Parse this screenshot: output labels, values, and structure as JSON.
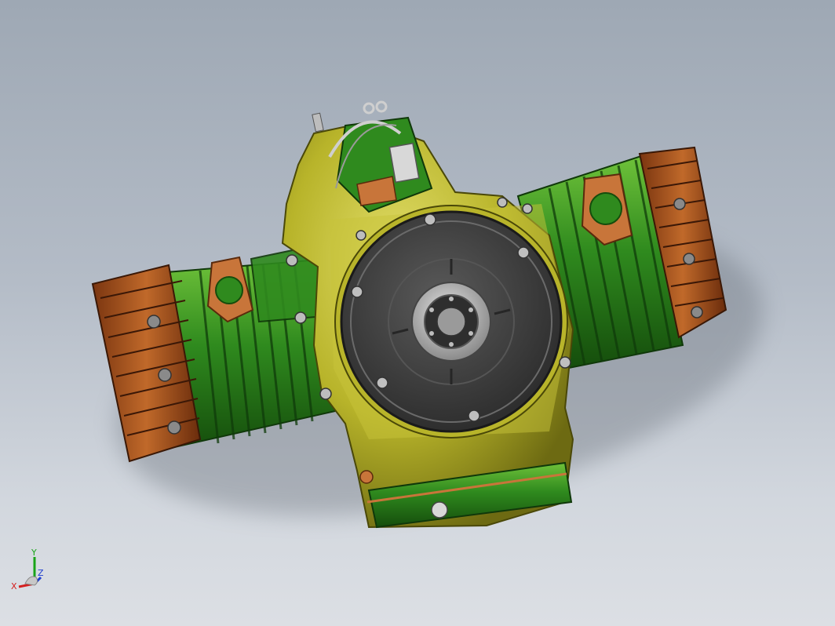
{
  "viewport": {
    "background_top": "#9ea8b4",
    "background_bottom": "#dcdfe4"
  },
  "model": {
    "parts": [
      {
        "name": "crankcase",
        "color": "#b8b42a"
      },
      {
        "name": "cylinder-left",
        "color": "#2f8a1e"
      },
      {
        "name": "cylinder-right",
        "color": "#2f8a1e"
      },
      {
        "name": "cylinder-head-left",
        "color": "#b0581c"
      },
      {
        "name": "cylinder-head-right",
        "color": "#b0581c"
      },
      {
        "name": "flywheel",
        "color": "#3c3c3c"
      },
      {
        "name": "oil-pan",
        "color": "#2f8a1e"
      },
      {
        "name": "exhaust-flange",
        "color": "#c8753a"
      }
    ]
  },
  "triad": {
    "x_label": "X",
    "y_label": "Y",
    "z_label": "Z",
    "x_color": "#d42020",
    "y_color": "#18a418",
    "z_color": "#2040d0"
  }
}
